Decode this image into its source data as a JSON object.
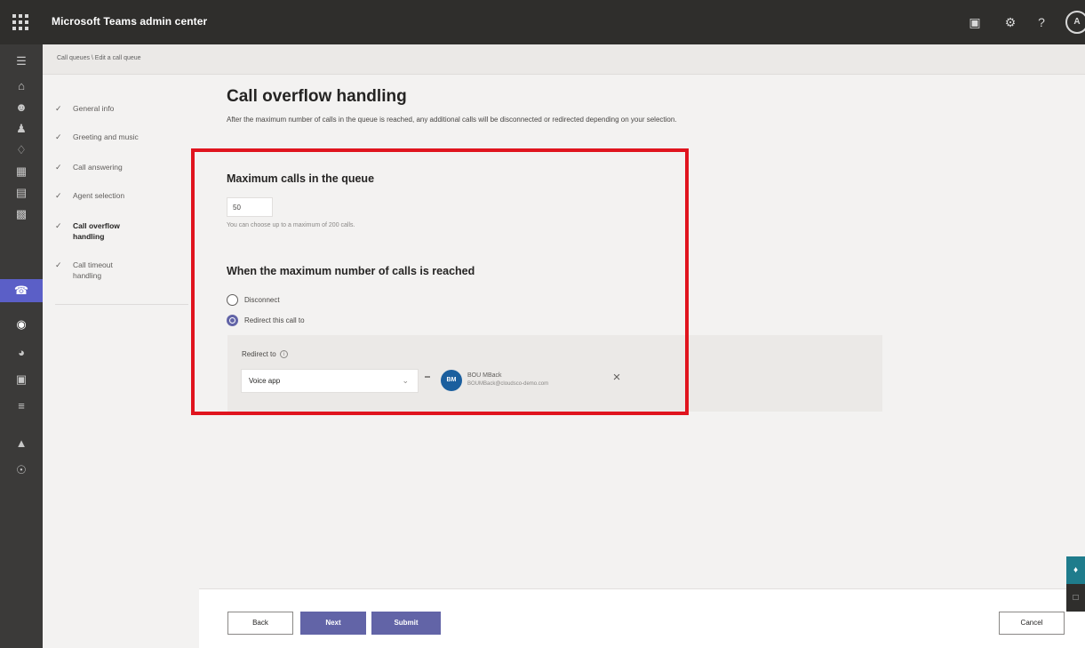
{
  "app": {
    "title": "Microsoft Teams admin center",
    "avatar_initial": "A"
  },
  "breadcrumb": "Call queues \\ Edit a call queue",
  "top_icons": [
    "screen-icon",
    "gear-icon",
    "help-icon"
  ],
  "left_rail": [
    "menu-icon",
    "home-icon",
    "teams-icon",
    "users-icon",
    "devices-icon",
    "locations-icon",
    "meetings-icon",
    "messaging-icon",
    "voice-icon",
    "apps-icon",
    "policy-packages-icon",
    "planning-icon",
    "analytics-icon",
    "notifications-icon"
  ],
  "stepper": {
    "steps": [
      {
        "label": "General info"
      },
      {
        "label": "Greeting and music"
      },
      {
        "label": "Call answering"
      },
      {
        "label": "Agent selection"
      },
      {
        "label_line1": "Call overflow",
        "label_line2": "handling"
      },
      {
        "label_line1": "Call timeout",
        "label_line2": "handling"
      }
    ]
  },
  "main": {
    "title": "Call overflow handling",
    "description": "After the maximum number of calls in the queue is reached, any additional calls will be disconnected or redirected depending on your selection.",
    "max_calls": {
      "title": "Maximum calls in the queue",
      "value": "50",
      "hint": "You can choose up to a maximum of 200 calls."
    },
    "when_reached": {
      "title": "When the maximum number of calls is reached",
      "options": [
        {
          "label": "Disconnect",
          "checked": false
        },
        {
          "label": "Redirect this call to",
          "checked": true
        }
      ],
      "redirect_to_label": "Redirect to",
      "redirect_type": "Voice app",
      "target": {
        "initials": "BM",
        "name": "BOU MBack",
        "email": "BOUMBack@cloudsco-demo.com"
      }
    }
  },
  "footer": {
    "back_label": "Back",
    "next_label": "Next",
    "submit_label": "Submit",
    "cancel_label": "Cancel"
  },
  "colors": {
    "accent": "#6264a7",
    "highlight": "#e0141e",
    "topbar": "#2f2e2c"
  }
}
